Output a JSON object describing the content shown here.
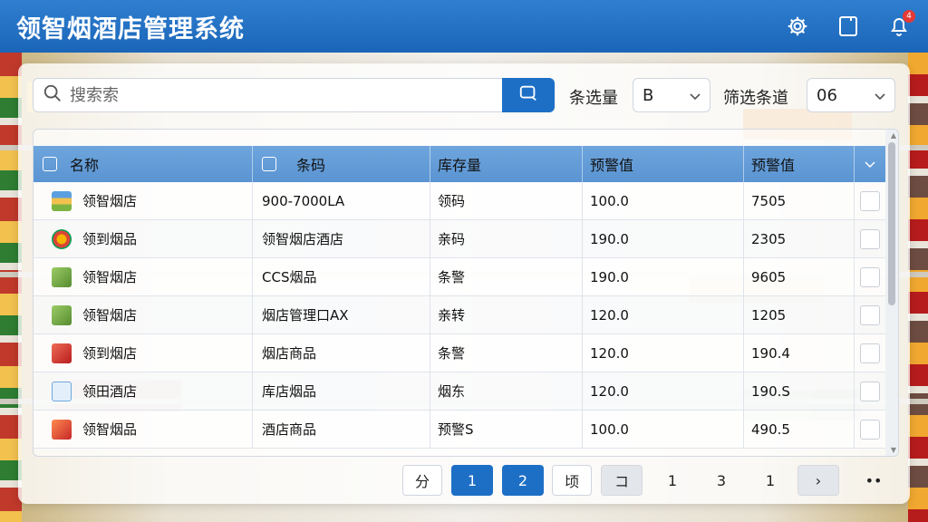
{
  "app": {
    "title": "领智烟酒店管理系统",
    "notification_count": "4"
  },
  "search": {
    "placeholder": "搜索索",
    "value": ""
  },
  "filters": [
    {
      "label": "条选量",
      "value": "B"
    },
    {
      "label": "筛选条道",
      "value": "06"
    }
  ],
  "table": {
    "headers": [
      "名称",
      "条码",
      "库存量",
      "预警值",
      "预警值"
    ],
    "rows": [
      {
        "icon": "book-stack-icon",
        "name": "领智烟店",
        "barcode": "900-7000LA",
        "stock": "领码",
        "warn1": "100.0",
        "warn2": "7505"
      },
      {
        "icon": "globe-badge-icon",
        "name": "领到烟品",
        "barcode": "领智烟店酒店",
        "stock": "亲码",
        "warn1": "190.0",
        "warn2": "2305"
      },
      {
        "icon": "green-box-icon",
        "name": "领智烟店",
        "barcode": "CCS烟品",
        "stock": "条警",
        "warn1": "190.0",
        "warn2": "9605"
      },
      {
        "icon": "green-box-icon",
        "name": "领智烟店",
        "barcode": "烟店管理口AX",
        "stock": "亲转",
        "warn1": "120.0",
        "warn2": "1205"
      },
      {
        "icon": "red-box-icon",
        "name": "领到烟店",
        "barcode": "烟店商品",
        "stock": "条警",
        "warn1": "120.0",
        "warn2": "190.4"
      },
      {
        "icon": "document-icon",
        "name": "领田酒店",
        "barcode": "库店烟品",
        "stock": "烟东",
        "warn1": "120.0",
        "warn2": "190.S"
      },
      {
        "icon": "orange-box-icon",
        "name": "领智烟品",
        "barcode": "酒店商品",
        "stock": "预警S",
        "warn1": "100.0",
        "warn2": "490.5"
      }
    ]
  },
  "pagination": {
    "items": [
      "分",
      "1",
      "2",
      "顷",
      "コ",
      "1",
      "3",
      "1",
      "›",
      "••"
    ]
  }
}
